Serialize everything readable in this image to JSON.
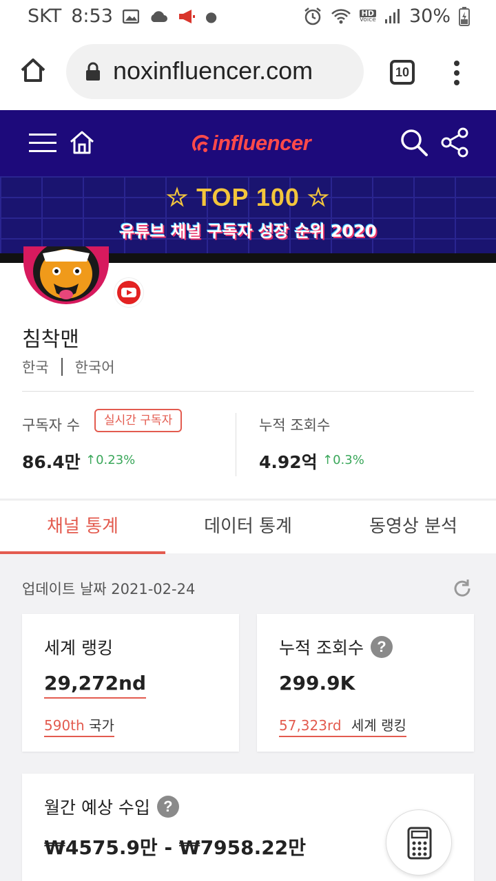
{
  "status_bar": {
    "carrier": "SKT",
    "time": "8:53",
    "hd_label": "HD",
    "voice_label": "Voice",
    "battery": "30%"
  },
  "browser": {
    "url": "noxinfluencer.com",
    "tab_count": "10"
  },
  "site_header": {
    "logo_text": "influencer"
  },
  "banner": {
    "title": "TOP 100",
    "subtitle": "유튜브 채널 구독자 성장 순위 2020"
  },
  "profile": {
    "channel_name": "침착맨",
    "country": "한국",
    "language": "한국어",
    "subscribers_label": "구독자 수",
    "live_subscribers_button": "실시간 구독자",
    "subscribers_value": "86.4만",
    "subscribers_change": "0.23%",
    "views_label": "누적 조회수",
    "views_value": "4.92억",
    "views_change": "0.3%"
  },
  "tabs": [
    {
      "label": "채널 통계",
      "active": true
    },
    {
      "label": "데이터 통계",
      "active": false
    },
    {
      "label": "동영상 분석",
      "active": false
    }
  ],
  "content": {
    "updated_text": "업데이트 날짜 2021-02-24",
    "world_ranking": {
      "label": "세계 랭킹",
      "value": "29,272nd",
      "country_rank": "590th",
      "country_rank_label": "국가"
    },
    "total_views": {
      "label": "누적 조회수",
      "value": "299.9K",
      "world_rank": "57,323rd",
      "world_rank_label": "세계 랭킹"
    },
    "monthly_income": {
      "label": "월간 예상 수입",
      "value": "₩4575.9만 - ₩7958.22만"
    }
  },
  "colors": {
    "accent": "#e35b4f",
    "header_bg": "#1d0a7b",
    "positive": "#3aa75a"
  }
}
